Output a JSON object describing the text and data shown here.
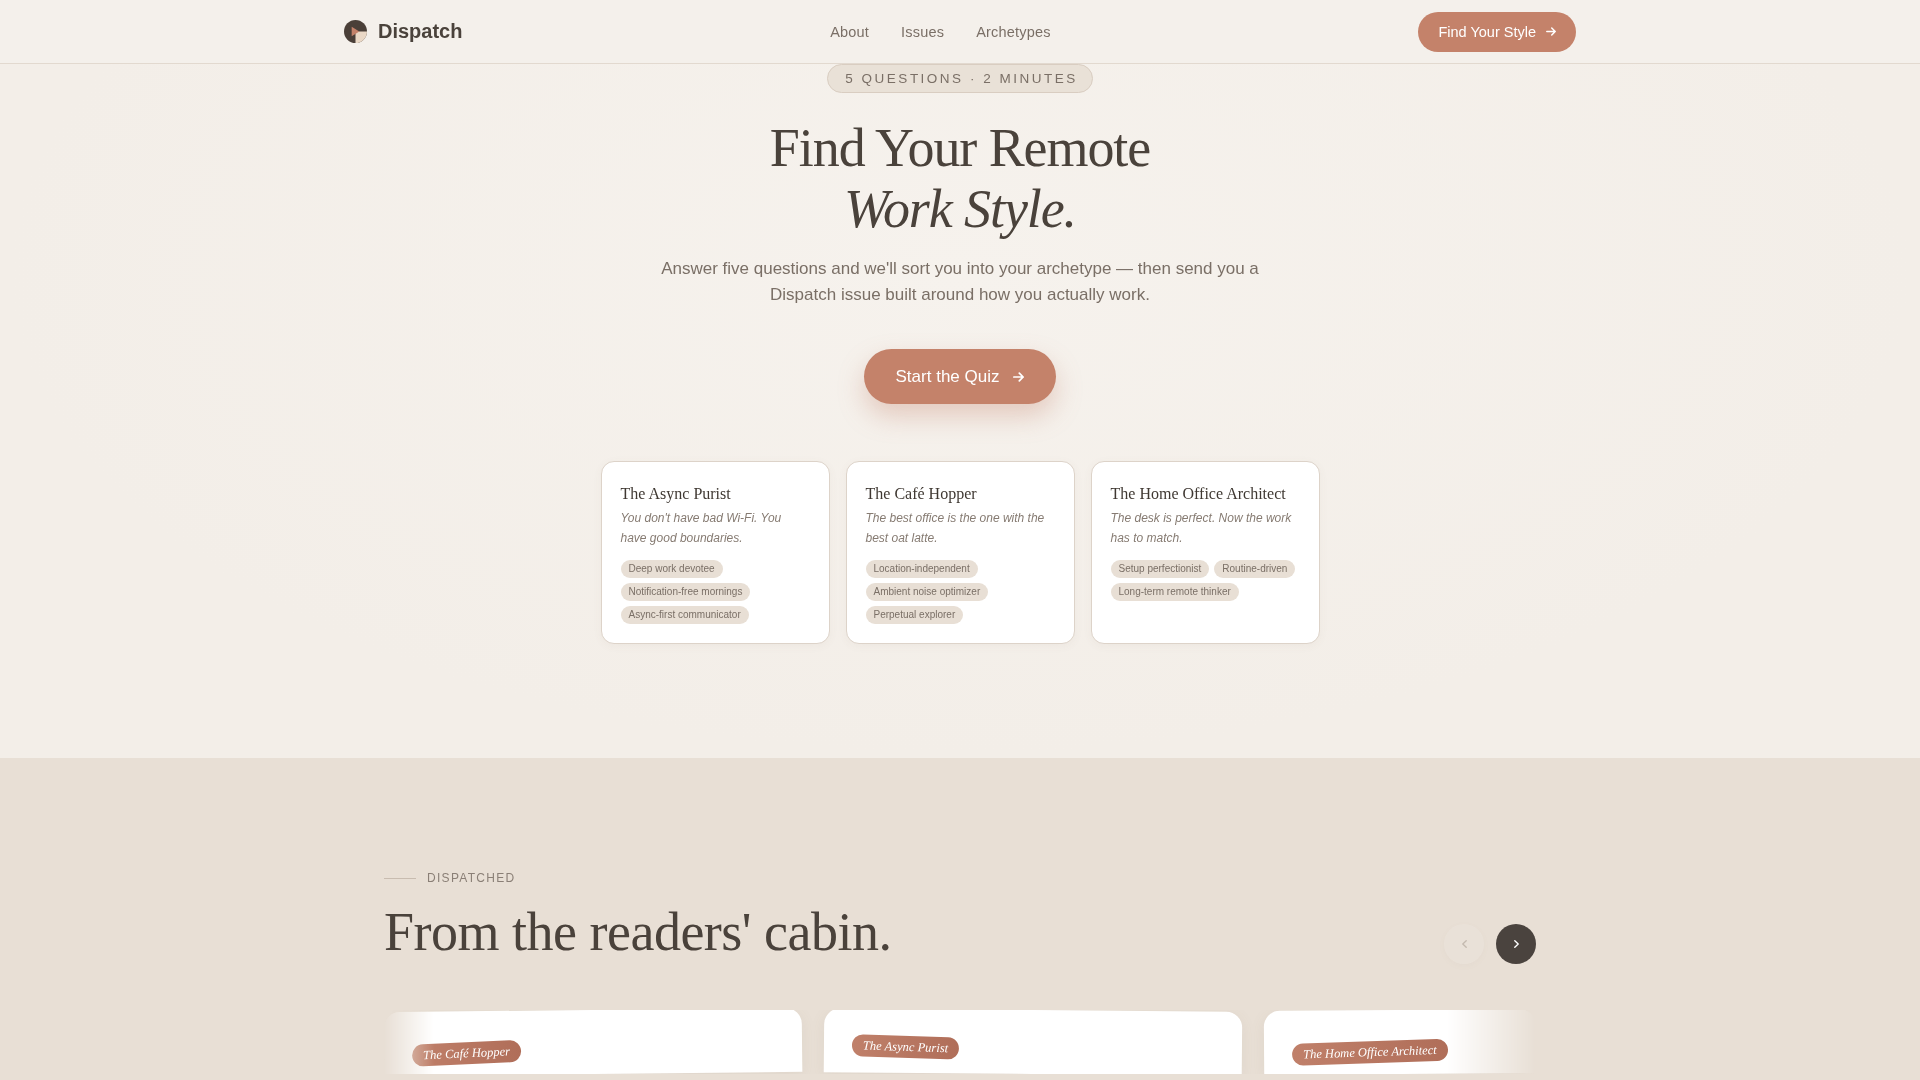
{
  "header": {
    "brand": "Dispatch",
    "nav": [
      "About",
      "Issues",
      "Archetypes"
    ],
    "cta": "Find Your Style"
  },
  "hero": {
    "badge": "5 QUESTIONS · 2 MINUTES",
    "title": "Find Your Remote *Work Style.*",
    "subtitle": "Answer five questions and we'll sort you into your archetype — then send you a Dispatch issue built around how you actually work.",
    "button": "Start the Quiz"
  },
  "archetypes": [
    {
      "name": "The Async Purist",
      "tagline": "You don't have bad Wi-Fi. You have good boundaries.",
      "traits": [
        "Deep work devotee",
        "Notification-free mornings",
        "Async-first communicator"
      ]
    },
    {
      "name": "The Café Hopper",
      "tagline": "The best office is the one with the best oat latte.",
      "traits": [
        "Location-independent",
        "Ambient noise optimizer",
        "Perpetual explorer"
      ]
    },
    {
      "name": "The Home Office Architect",
      "tagline": "The desk is perfect. Now the work has to match.",
      "traits": [
        "Setup perfectionist",
        "Routine-driven",
        "Long-term remote thinker"
      ]
    }
  ],
  "dispatched": {
    "eyebrow": "DISPATCHED",
    "title": "From the readers' cabin.",
    "controls": [
      {
        "kind": "prev",
        "disabled": true
      },
      {
        "kind": "next",
        "disabled": false
      }
    ],
    "cards": [
      {
        "tag": "The Café Hopper"
      },
      {
        "tag": "The Async Purist"
      },
      {
        "tag": "The Home Office Architect"
      }
    ]
  }
}
